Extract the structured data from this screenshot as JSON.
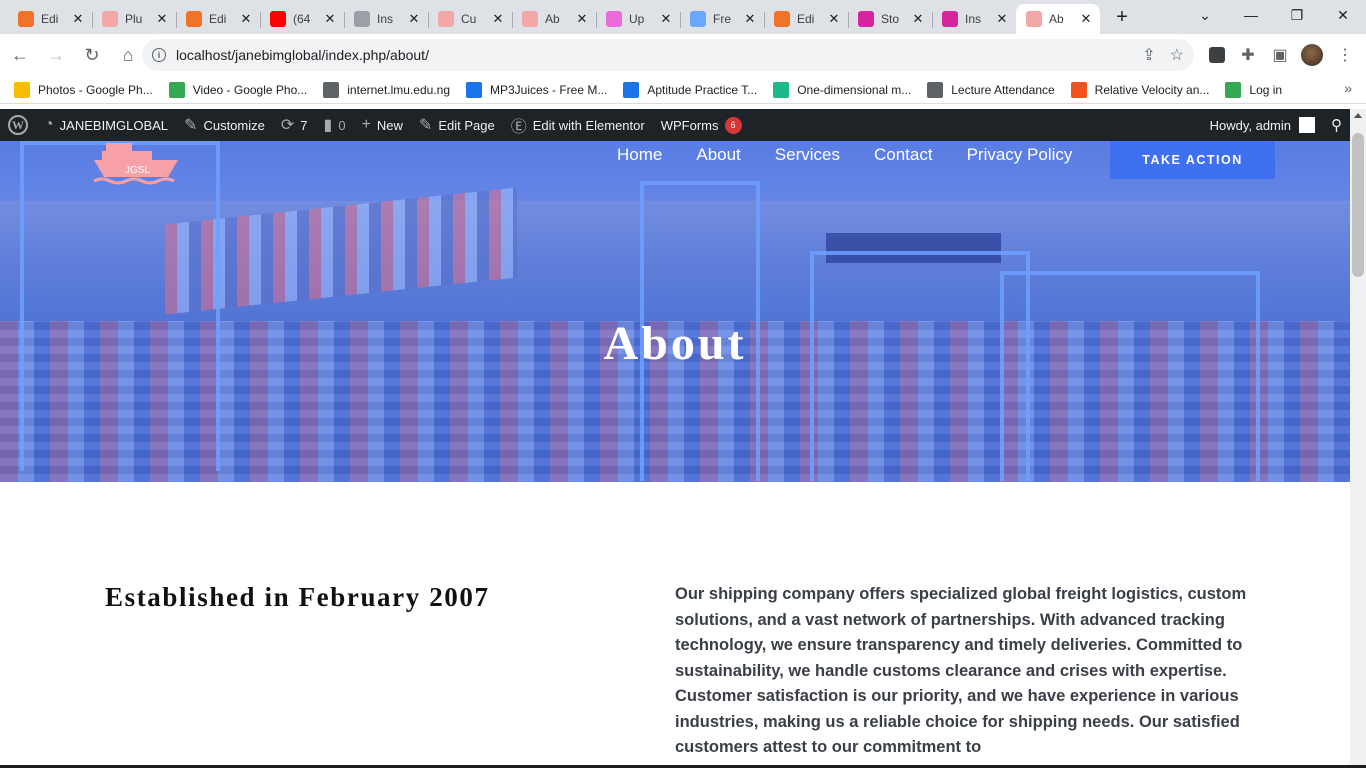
{
  "browser": {
    "tabs": [
      {
        "title": "Edi",
        "icon": "xampp-icon",
        "color": "#f0732a"
      },
      {
        "title": "Plu",
        "icon": "wpforms-icon",
        "color": "#f3a8a8"
      },
      {
        "title": "Edi",
        "icon": "xampp-icon",
        "color": "#f0732a"
      },
      {
        "title": "(64",
        "icon": "youtube-icon",
        "color": "#ff0000"
      },
      {
        "title": "Ins",
        "icon": "globe-icon",
        "color": "#9aa0a6"
      },
      {
        "title": "Cu",
        "icon": "wpforms-icon",
        "color": "#f3a8a8"
      },
      {
        "title": "Ab",
        "icon": "wpforms-icon",
        "color": "#f3a8a8"
      },
      {
        "title": "Up",
        "icon": "elementor-icon",
        "color": "#e86bd9"
      },
      {
        "title": "Fre",
        "icon": "freepik-icon",
        "color": "#6aa7ff"
      },
      {
        "title": "Edi",
        "icon": "xampp-icon",
        "color": "#f0732a"
      },
      {
        "title": "Sto",
        "icon": "instagram-icon",
        "color": "#d6249f"
      },
      {
        "title": "Ins",
        "icon": "instagram-icon",
        "color": "#d6249f"
      },
      {
        "title": "Ab",
        "icon": "wpforms-icon",
        "color": "#f3a8a8",
        "active": true
      }
    ],
    "url": "localhost/janebimglobal/index.php/about/"
  },
  "bookmarks": [
    {
      "label": "Photos - Google Ph...",
      "icon": "google-photos-icon",
      "color": "#fbbc04"
    },
    {
      "label": "Video - Google Pho...",
      "icon": "google-photos-icon",
      "color": "#34a853"
    },
    {
      "label": "internet.lmu.edu.ng",
      "icon": "globe-icon",
      "color": "#5f6368"
    },
    {
      "label": "MP3Juices - Free M...",
      "icon": "download-icon",
      "color": "#1a73e8"
    },
    {
      "label": "Aptitude Practice T...",
      "icon": "g-icon",
      "color": "#1a73e8"
    },
    {
      "label": "One-dimensional m...",
      "icon": "hex-icon",
      "color": "#1db98a"
    },
    {
      "label": "Lecture Attendance",
      "icon": "globe-icon",
      "color": "#5f6368"
    },
    {
      "label": "Relative Velocity an...",
      "icon": "star-logo-icon",
      "color": "#f4511e"
    },
    {
      "label": "Log in",
      "icon": "user-icon",
      "color": "#34a853"
    }
  ],
  "wpbar": {
    "site": "JANEBIMGLOBAL",
    "customize": "Customize",
    "updates": "7",
    "comments": "0",
    "new": "New",
    "edit_page": "Edit Page",
    "elementor": "Edit with Elementor",
    "wpforms": "WPForms",
    "wpforms_badge": "6",
    "howdy": "Howdy, admin"
  },
  "site": {
    "logo_text": "JGSL",
    "nav": [
      "Home",
      "About",
      "Services",
      "Contact",
      "Privacy Policy"
    ],
    "cta": "TAKE ACTION",
    "hero_title": "About",
    "heading": "Established in February 2007",
    "body": "Our shipping company offers specialized global freight logistics, custom solutions, and a vast network of partnerships. With advanced tracking technology, we ensure transparency and timely deliveries. Committed to sustainability, we handle customs clearance and crises with expertise. Customer satisfaction is our priority, and we have experience in various industries, making us a reliable choice for shipping needs. Our satisfied customers attest to our commitment to"
  }
}
